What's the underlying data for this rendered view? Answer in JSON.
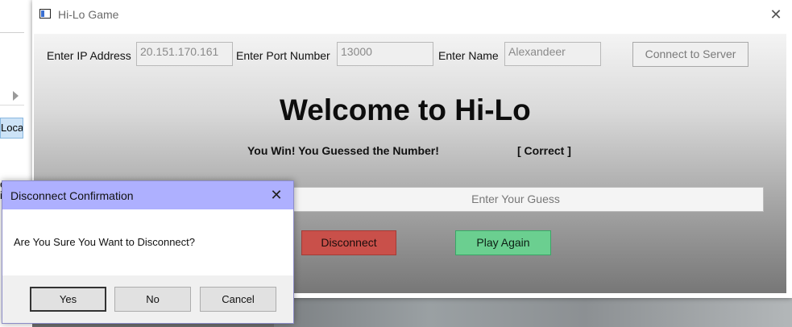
{
  "background": {
    "partial_label": "Loca",
    "glyphs": [
      "e",
      "i"
    ]
  },
  "window": {
    "title": "Hi-Lo Game",
    "icon": "app-window-icon",
    "close_icon": "close-icon"
  },
  "connection": {
    "ip_label": "Enter IP Address",
    "ip_value": "20.151.170.161",
    "port_label": "Enter Port Number",
    "port_value": "13000",
    "name_label": "Enter Name",
    "name_value": "Alexandeer",
    "connect_button": "Connect to Server"
  },
  "game": {
    "heading": "Welcome to Hi-Lo",
    "message": "You Win! You Guessed the Number!",
    "status": "[ Correct ]",
    "guess_placeholder": "Enter Your Guess",
    "disconnect_button": "Disconnect",
    "play_again_button": "Play Again",
    "colors": {
      "disconnect": "#c9504a",
      "play_again": "#6bcf90"
    }
  },
  "dialog": {
    "title": "Disconnect Confirmation",
    "message": "Are You Sure You Want to Disconnect?",
    "buttons": {
      "yes": "Yes",
      "no": "No",
      "cancel": "Cancel"
    },
    "title_color": "#aeb0ff"
  }
}
